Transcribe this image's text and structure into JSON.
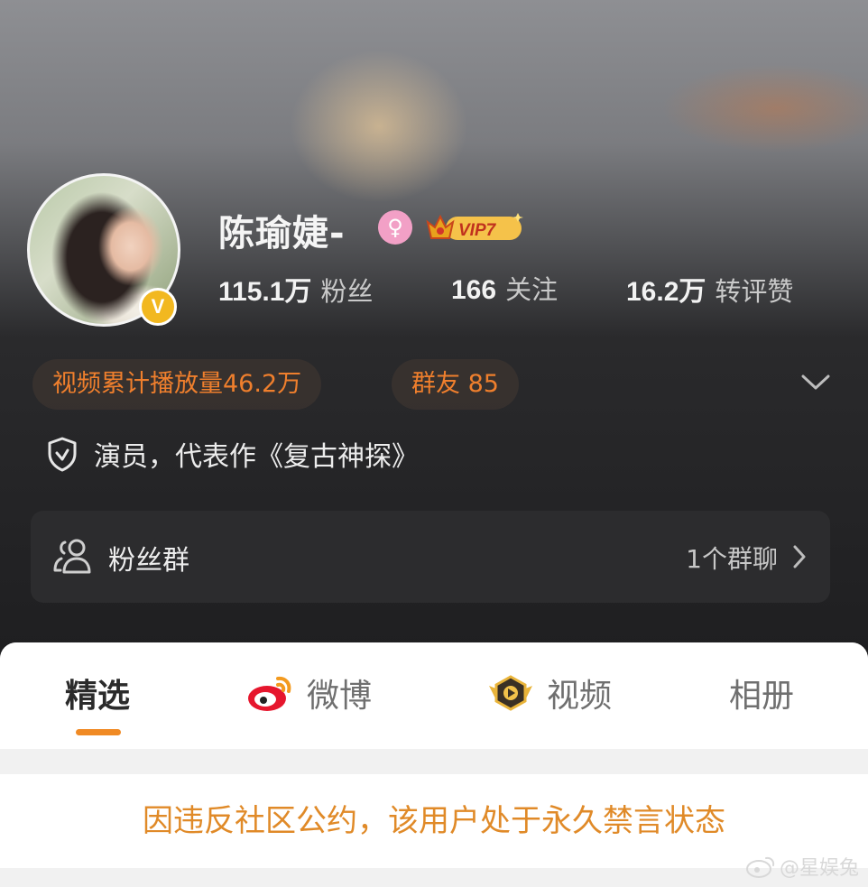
{
  "profile": {
    "name": "陈瑜婕-",
    "gender_icon": "female-icon",
    "verified_badge": "V",
    "vip_label": "VIP7",
    "stats": [
      {
        "value": "115.1万",
        "label": "粉丝"
      },
      {
        "value": "166",
        "label": "关注"
      },
      {
        "value": "16.2万",
        "label": "转评赞"
      }
    ],
    "chips": [
      {
        "text": "视频累计播放量46.2万"
      },
      {
        "text": "群友 85"
      }
    ],
    "description": "演员，代表作《复古神探》"
  },
  "fans_group": {
    "label": "粉丝群",
    "count": "1个群聊"
  },
  "tabs": [
    {
      "label": "精选",
      "active": true
    },
    {
      "label": "微博",
      "icon": "weibo-icon"
    },
    {
      "label": "视频",
      "icon": "video-badge-icon"
    },
    {
      "label": "相册"
    }
  ],
  "notice": "因违反社区公约，该用户处于永久禁言状态",
  "watermark": "@星娱兔",
  "colors": {
    "accent": "#f08a24",
    "chip_text": "#ef7f2d",
    "notice_text": "#e08a28",
    "verified": "#f2b820",
    "gender": "#f2a0c6"
  }
}
